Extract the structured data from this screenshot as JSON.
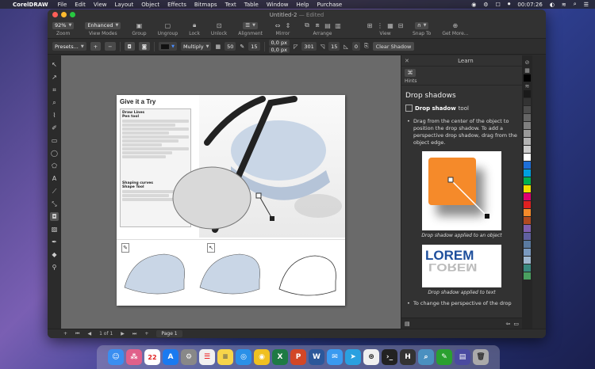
{
  "menubar": {
    "app_name": "CorelDRAW",
    "items": [
      "File",
      "Edit",
      "View",
      "Layout",
      "Object",
      "Effects",
      "Bitmaps",
      "Text",
      "Table",
      "Window",
      "Help",
      "Purchase"
    ],
    "time": "00:07:26"
  },
  "window": {
    "title": "Untitled-2",
    "edited": "— Edited"
  },
  "toolbar1": {
    "zoom_value": "92%",
    "zoom_label": "Zoom",
    "view_mode_value": "Enhanced",
    "view_modes_label": "View Modes",
    "group_label": "Group",
    "ungroup_label": "Ungroup",
    "lock_label": "Lock",
    "unlock_label": "Unlock",
    "alignment_label": "Alignment",
    "mirror_label": "Mirror",
    "arrange_label": "Arrange",
    "view_label": "View",
    "snap_to_label": "Snap To",
    "get_more_label": "Get More..."
  },
  "toolbar2": {
    "presets": "Presets...",
    "merge_mode": "Multiply",
    "opacity": "50",
    "feather": "15",
    "offset_x": "0,0 px",
    "offset_y": "0,0 px",
    "direction": "301",
    "stretch": "15",
    "fade": "0",
    "clear_shadow": "Clear Shadow"
  },
  "page": {
    "title": "Give it a Try",
    "section1_title": "Draw Lines",
    "section1_sub": "Pen tool",
    "section2_title": "Shaping curves",
    "section2_sub": "Shape Tool"
  },
  "docker": {
    "header": "Learn",
    "hints_label": "Hints",
    "heading": "Drop shadows",
    "tool_name": "Drop shadow",
    "tool_suffix": "tool",
    "para1": "Drag from the center of the object to position the drop shadow. To add a perspective drop shadow, drag from the object edge.",
    "caption1": "Drop shadow applied to an object",
    "lorem": "LOREM",
    "caption2": "Drop shadow applied to text",
    "para2": "To change the perspective of the drop"
  },
  "statusbar": {
    "page_info": "1 of 1",
    "page_tab": "Page 1"
  },
  "dock": {
    "calendar_day": "22"
  },
  "colors": {
    "accent_orange": "#f58a2a",
    "lorem_blue": "#1e4f9c"
  }
}
